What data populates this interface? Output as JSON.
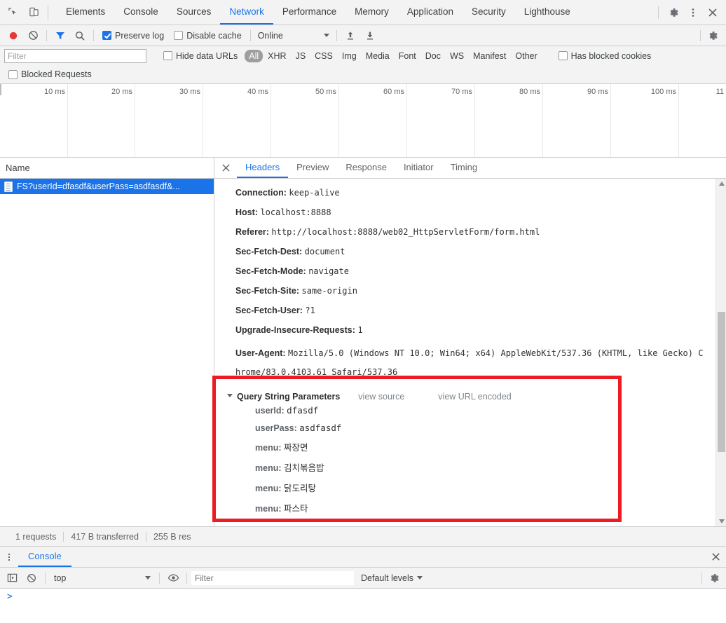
{
  "main_tabs": {
    "items": [
      {
        "label": "Elements",
        "active": false
      },
      {
        "label": "Console",
        "active": false
      },
      {
        "label": "Sources",
        "active": false
      },
      {
        "label": "Network",
        "active": true
      },
      {
        "label": "Performance",
        "active": false
      },
      {
        "label": "Memory",
        "active": false
      },
      {
        "label": "Application",
        "active": false
      },
      {
        "label": "Security",
        "active": false
      },
      {
        "label": "Lighthouse",
        "active": false
      }
    ],
    "inspect_icon": "inspect-element-icon",
    "device_icon": "device-toolbar-icon",
    "settings_icon": "gear-icon",
    "more_icon": "more-vertical-icon",
    "close_icon": "close-icon"
  },
  "network_toolbar": {
    "record_icon": "record-icon",
    "clear_icon": "clear-icon",
    "filter_icon": "filter-funnel-icon",
    "search_icon": "search-icon",
    "preserve_log": {
      "label": "Preserve log",
      "checked": true
    },
    "disable_cache": {
      "label": "Disable cache",
      "checked": false
    },
    "throttling": {
      "value": "Online"
    },
    "import_icon": "import-har-icon",
    "export_icon": "export-har-icon",
    "settings_icon": "gear-icon"
  },
  "filter_bar": {
    "filter_placeholder": "Filter",
    "filter_value": "",
    "hide_data_urls": {
      "label": "Hide data URLs",
      "checked": false
    },
    "resource_types": [
      "All",
      "XHR",
      "JS",
      "CSS",
      "Img",
      "Media",
      "Font",
      "Doc",
      "WS",
      "Manifest",
      "Other"
    ],
    "selected_type": "All",
    "has_blocked_cookies": {
      "label": "Has blocked cookies",
      "checked": false
    },
    "blocked_requests": {
      "label": "Blocked Requests",
      "checked": false
    }
  },
  "timeline": {
    "ticks": [
      "10 ms",
      "20 ms",
      "30 ms",
      "40 ms",
      "50 ms",
      "60 ms",
      "70 ms",
      "80 ms",
      "90 ms",
      "100 ms",
      "11"
    ]
  },
  "request_list": {
    "column_header": "Name",
    "rows": [
      {
        "name": "FS?userId=dfasdf&userPass=asdfasdf&...",
        "selected": true,
        "icon": "document-icon"
      }
    ]
  },
  "detail_tabs": {
    "close_icon": "close-icon",
    "items": [
      {
        "label": "Headers",
        "active": true
      },
      {
        "label": "Preview",
        "active": false
      },
      {
        "label": "Response",
        "active": false
      },
      {
        "label": "Initiator",
        "active": false
      },
      {
        "label": "Timing",
        "active": false
      }
    ]
  },
  "headers": [
    {
      "name": "Connection:",
      "value": "keep-alive"
    },
    {
      "name": "Host:",
      "value": "localhost:8888"
    },
    {
      "name": "Referer:",
      "value": "http://localhost:8888/web02_HttpServletForm/form.html"
    },
    {
      "name": "Sec-Fetch-Dest:",
      "value": "document"
    },
    {
      "name": "Sec-Fetch-Mode:",
      "value": "navigate"
    },
    {
      "name": "Sec-Fetch-Site:",
      "value": "same-origin"
    },
    {
      "name": "Sec-Fetch-User:",
      "value": "?1"
    },
    {
      "name": "Upgrade-Insecure-Requests:",
      "value": "1"
    },
    {
      "name": "User-Agent:",
      "value": "Mozilla/5.0 (Windows NT 10.0; Win64; x64) AppleWebKit/537.36 (KHTML, like Gecko) Chrome/83.0.4103.61 Safari/537.36"
    }
  ],
  "query_string": {
    "title": "Query String Parameters",
    "view_source_label": "view source",
    "view_url_encoded_label": "view URL encoded",
    "expanded": true,
    "params": [
      {
        "name": "userId:",
        "value": "dfasdf",
        "korean": false
      },
      {
        "name": "userPass:",
        "value": "asdfasdf",
        "korean": false
      },
      {
        "name": "menu:",
        "value": "짜장면",
        "korean": true
      },
      {
        "name": "menu:",
        "value": "김치볶음밥",
        "korean": true
      },
      {
        "name": "menu:",
        "value": "닭도리탕",
        "korean": true
      },
      {
        "name": "menu:",
        "value": "파스타",
        "korean": true
      }
    ],
    "highlight_color": "#ed1c24"
  },
  "status_bar": {
    "requests": "1 requests",
    "transferred": "417 B transferred",
    "resources": "255 B res"
  },
  "drawer": {
    "more_icon": "more-vertical-icon",
    "tabs": [
      {
        "label": "Console",
        "active": true
      }
    ],
    "close_icon": "close-icon",
    "toolbar": {
      "sidebar_icon": "console-sidebar-icon",
      "clear_icon": "clear-console-icon",
      "context": "top",
      "live_expression_icon": "eye-icon",
      "filter_placeholder": "Filter",
      "filter_value": "",
      "levels": "Default levels",
      "settings_icon": "gear-icon"
    },
    "prompt_symbol": ">"
  },
  "colors": {
    "accent": "#1a73e8",
    "toolbar_bg": "#f3f3f3",
    "border": "#cdcdcd",
    "record": "#e53935",
    "highlight": "#ed1c24"
  }
}
